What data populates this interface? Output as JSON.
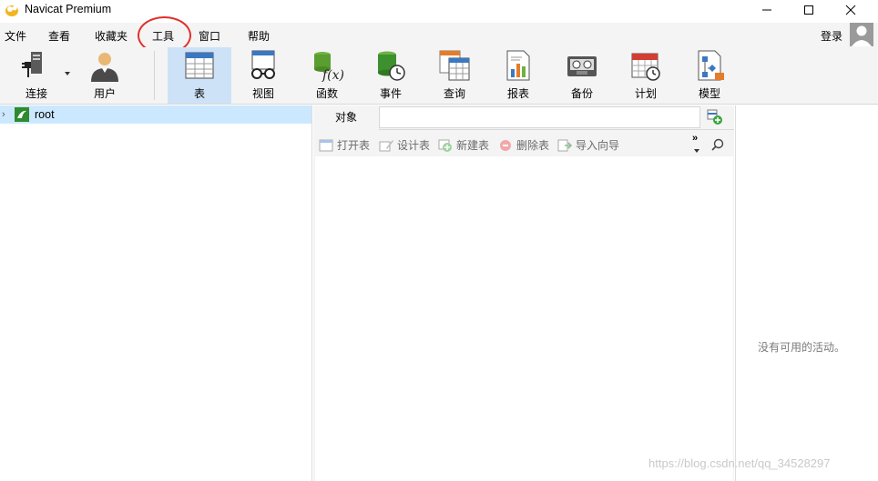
{
  "window": {
    "title": "Navicat Premium"
  },
  "menu": {
    "items": [
      "文件",
      "查看",
      "收藏夹",
      "工具",
      "窗口",
      "帮助"
    ],
    "login": "登录"
  },
  "toolbar": {
    "connect": "连接",
    "user": "用户",
    "table": "表",
    "view": "视图",
    "function": "函数",
    "event": "事件",
    "query": "查询",
    "report": "报表",
    "backup": "备份",
    "schedule": "计划",
    "model": "模型"
  },
  "tree": {
    "root": "root"
  },
  "objects": {
    "tab": "对象",
    "open": "打开表",
    "design": "设计表",
    "new": "新建表",
    "delete": "删除表",
    "import": "导入向导",
    "more": "»"
  },
  "activity": {
    "empty": "没有可用的活动。"
  },
  "watermark": "https://blog.csdn.net/qq_34528297",
  "colors": {
    "accent_active": "#cde2f6",
    "tree_selected": "#cce8ff",
    "annotation": "#e0302a"
  }
}
